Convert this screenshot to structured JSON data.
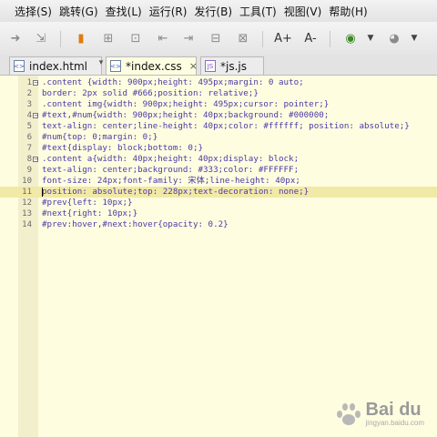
{
  "menu": [
    "选择(S)",
    "跳转(G)",
    "查找(L)",
    "运行(R)",
    "发行(B)",
    "工具(T)",
    "视图(V)",
    "帮助(H)"
  ],
  "toolbar": {
    "icons": [
      "redo-icon",
      "pin-icon",
      "bookmark-icon",
      "insert-icon",
      "save-icon",
      "history-back-icon",
      "history-forward-icon",
      "comment-icon",
      "uncomment-icon",
      "font-increase-icon",
      "font-decrease-icon",
      "run-icon",
      "settings-icon"
    ],
    "font_increase_glyph": "A+",
    "font_decrease_glyph": "A-"
  },
  "tabs": [
    {
      "label": "index.html",
      "icon_text": "<>",
      "active": false
    },
    {
      "label": "*index.css",
      "icon_text": "<>",
      "active": true,
      "close": "×"
    },
    {
      "label": "*js.js",
      "icon_text": "JS",
      "active": false
    }
  ],
  "editor": {
    "current_line": 11,
    "lines": [
      {
        "n": "1",
        "fold": "−",
        "text": ".content {width: 900px;height: 495px;margin: 0 auto;"
      },
      {
        "n": "2",
        "fold": "",
        "text": "border: 2px solid #666;position: relative;}"
      },
      {
        "n": "3",
        "fold": "",
        "text": ".content img{width: 900px;height: 495px;cursor: pointer;}"
      },
      {
        "n": "4",
        "fold": "−",
        "text": "#text,#num{width: 900px;height: 40px;background: #000000;"
      },
      {
        "n": "5",
        "fold": "",
        "text": "text-align: center;line-height: 40px;color: #ffffff; position: absolute;}"
      },
      {
        "n": "6",
        "fold": "",
        "text": "#num{top: 0;margin: 0;}"
      },
      {
        "n": "7",
        "fold": "",
        "text": "#text{display: block;bottom: 0;}"
      },
      {
        "n": "8",
        "fold": "−",
        "text": ".content a{width: 40px;height: 40px;display: block;"
      },
      {
        "n": "9",
        "fold": "",
        "text": "text-align: center;background: #333;color: #FFFFFF;"
      },
      {
        "n": "10",
        "fold": "",
        "text": "font-size: 24px;font-family: 宋体;line-height: 40px;"
      },
      {
        "n": "11",
        "fold": "",
        "text": "position: absolute;top: 228px;text-decoration: none;}"
      },
      {
        "n": "12",
        "fold": "",
        "text": "#prev{left: 10px;}"
      },
      {
        "n": "13",
        "fold": "",
        "text": "#next{right: 10px;}"
      },
      {
        "n": "14",
        "fold": "",
        "text": "#prev:hover,#next:hover{opacity: 0.2}"
      }
    ]
  },
  "watermark": {
    "brand": "Bai du",
    "sub": "jingyan.baidu.com"
  }
}
